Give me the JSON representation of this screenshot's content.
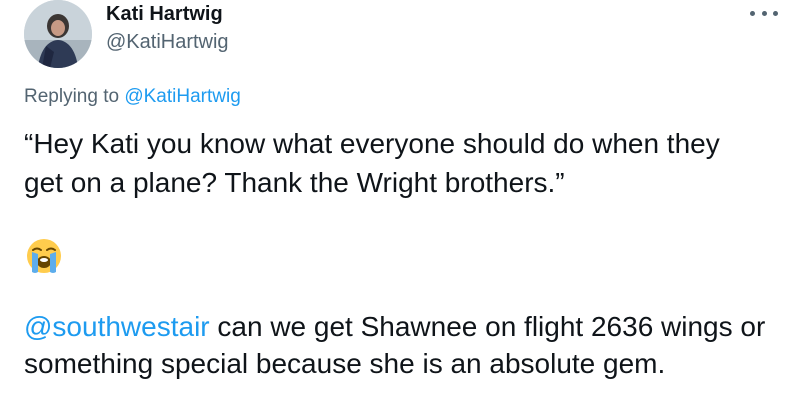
{
  "author": {
    "name": "Kati Hartwig",
    "handle": "@KatiHartwig",
    "avatar_icon": "profile-photo"
  },
  "menu": {
    "icon": "more-options-icon"
  },
  "reply": {
    "prefix": "Replying to ",
    "mention": "@KatiHartwig"
  },
  "tweet": {
    "quote_text": "“Hey Kati you know what everyone should do when they get on a plane? Thank the Wright brothers.”",
    "emoji": "loudly-crying-face-icon",
    "mention": "@southwestair",
    "body_text": " can we get Shawnee on flight 2636 wings or something special because she is an absolute gem."
  },
  "colors": {
    "link": "#1d9bf0",
    "secondary_text": "#536471",
    "primary_text": "#0f1419"
  }
}
